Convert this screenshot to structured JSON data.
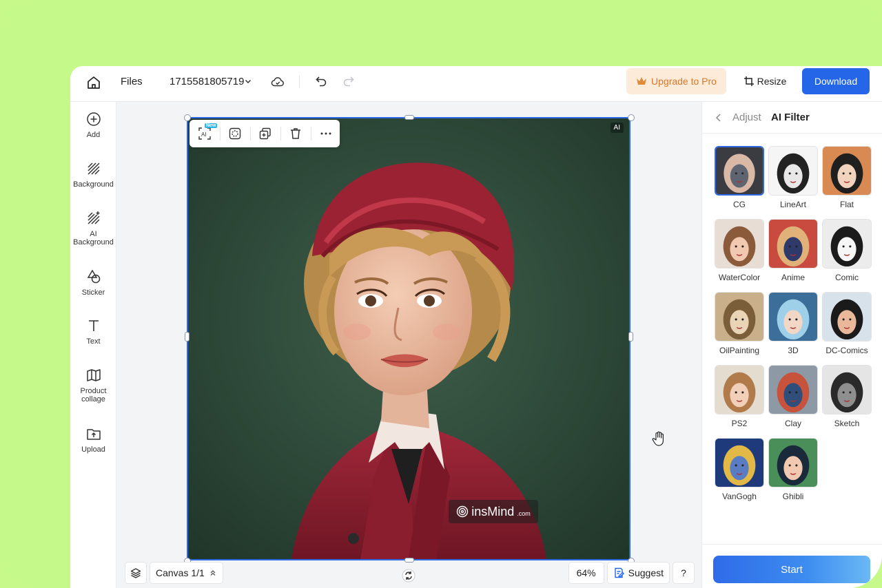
{
  "topbar": {
    "files_label": "Files",
    "project_name": "1715581805719",
    "upgrade_label": "Upgrade to Pro",
    "resize_label": "Resize",
    "download_label": "Download"
  },
  "sidebar": {
    "items": [
      {
        "label": "Add",
        "icon": "plus-circle-icon"
      },
      {
        "label": "Background",
        "icon": "hatch-icon"
      },
      {
        "label": "AI\nBackground",
        "icon": "ai-hatch-icon"
      },
      {
        "label": "Sticker",
        "icon": "shapes-icon"
      },
      {
        "label": "Text",
        "icon": "text-icon"
      },
      {
        "label": "Product\ncollage",
        "icon": "map-icon"
      },
      {
        "label": "Upload",
        "icon": "upload-icon"
      }
    ]
  },
  "canvas": {
    "ai_tag": "AI",
    "new_badge": "New",
    "watermark_brand": "insMind",
    "watermark_suffix": ".com",
    "page_label": "Canvas 1/1",
    "zoom": "64%",
    "suggest_label": "Suggest",
    "help_label": "?"
  },
  "panel": {
    "tab_adjust": "Adjust",
    "tab_filter": "AI Filter",
    "filters": [
      {
        "name": "CG",
        "selected": true
      },
      {
        "name": "LineArt"
      },
      {
        "name": "Flat"
      },
      {
        "name": "WaterColor"
      },
      {
        "name": "Anime"
      },
      {
        "name": "Comic"
      },
      {
        "name": "OilPainting"
      },
      {
        "name": "3D"
      },
      {
        "name": "DC-Comics"
      },
      {
        "name": "PS2"
      },
      {
        "name": "Clay"
      },
      {
        "name": "Sketch"
      },
      {
        "name": "VanGogh"
      },
      {
        "name": "Ghibli"
      }
    ],
    "start_label": "Start"
  },
  "colors": {
    "frame_bg": "#c5f98a",
    "accent": "#2565e8",
    "upgrade_bg": "#fdebd9",
    "upgrade_text": "#d9772a",
    "canvas_bg": "#2f4a3c"
  }
}
